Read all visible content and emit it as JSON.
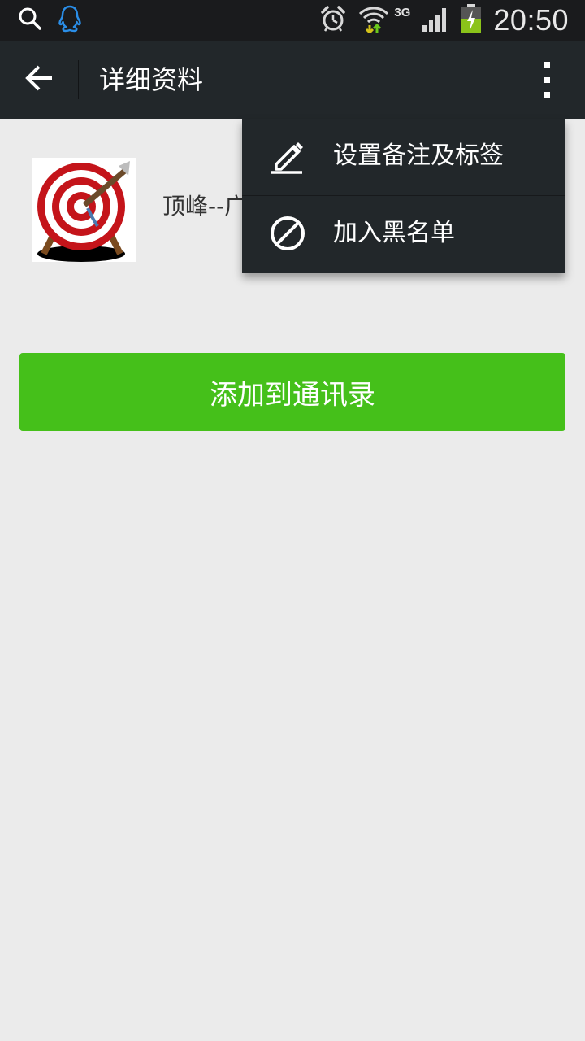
{
  "status_bar": {
    "time": "20:50",
    "network_type": "3G",
    "icons": [
      "search-icon",
      "qq-icon",
      "alarm-icon",
      "wifi-icon",
      "signal-icon",
      "battery-charging-icon"
    ]
  },
  "header": {
    "title": "详细资料",
    "back_icon": "back-arrow-icon",
    "more_icon": "more-vertical-icon"
  },
  "profile": {
    "nickname": "顶峰--广"
  },
  "add_button_label": "添加到通讯录",
  "popup_menu": {
    "items": [
      {
        "label": "设置备注及标签",
        "icon": "edit-pencil-icon"
      },
      {
        "label": "加入黑名单",
        "icon": "block-icon"
      }
    ]
  },
  "colors": {
    "status_bar_bg": "#1a1b1d",
    "action_bar_bg": "#22272a",
    "page_bg": "#ebebeb",
    "button_green": "#45c01a",
    "qq_blue": "#2a8ee8"
  }
}
